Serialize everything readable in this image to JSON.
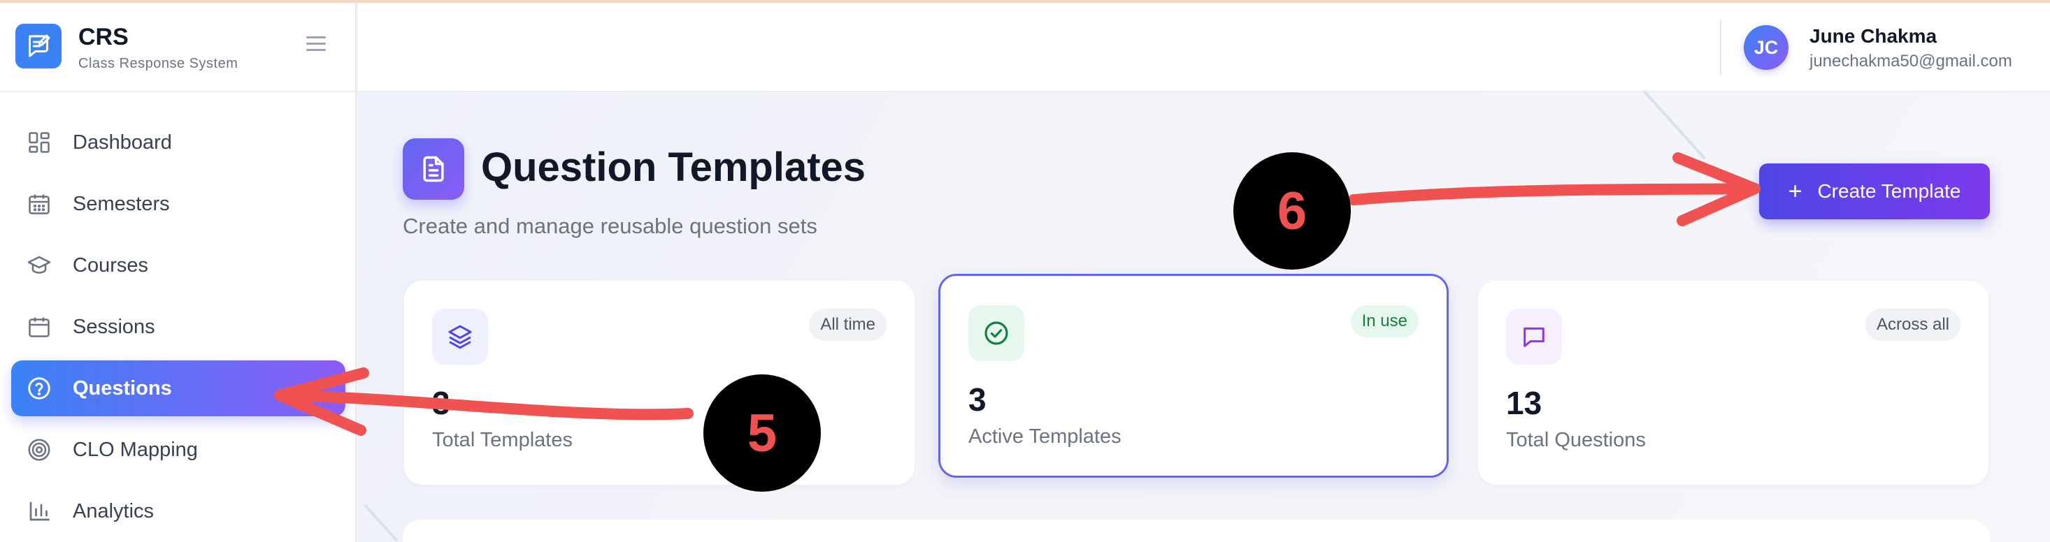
{
  "brand": {
    "name": "CRS",
    "subtitle": "Class Response System"
  },
  "sidebar": {
    "items": [
      {
        "label": "Dashboard",
        "icon": "dashboard-icon"
      },
      {
        "label": "Semesters",
        "icon": "calendar-icon"
      },
      {
        "label": "Courses",
        "icon": "graduation-cap-icon"
      },
      {
        "label": "Sessions",
        "icon": "calendar-icon"
      },
      {
        "label": "Questions",
        "icon": "help-circle-icon",
        "active": true
      },
      {
        "label": "CLO Mapping",
        "icon": "target-icon"
      },
      {
        "label": "Analytics",
        "icon": "bar-chart-icon"
      }
    ]
  },
  "user": {
    "initials": "JC",
    "name": "June Chakma",
    "email": "junechakma50@gmail.com"
  },
  "page": {
    "title": "Question Templates",
    "subtitle": "Create and manage reusable question sets",
    "create_label": "Create Template"
  },
  "stats": [
    {
      "value": "3",
      "label": "Total Templates",
      "badge": "All time",
      "icon": "layers-icon"
    },
    {
      "value": "3",
      "label": "Active Templates",
      "badge": "In use",
      "icon": "check-circle-icon"
    },
    {
      "value": "13",
      "label": "Total Questions",
      "badge": "Across all",
      "icon": "message-square-icon"
    }
  ],
  "annotations": [
    {
      "number": "5",
      "target": "Questions"
    },
    {
      "number": "6",
      "target": "Create Template"
    }
  ],
  "colors": {
    "accent": "#4f46e5",
    "accent_secondary": "#7c3aed",
    "active_nav_start": "#3b82f6",
    "active_nav_end": "#8b5cf6",
    "annotation_arrow": "#f05252",
    "annotation_marker": "#000000",
    "success": "#15803d"
  }
}
